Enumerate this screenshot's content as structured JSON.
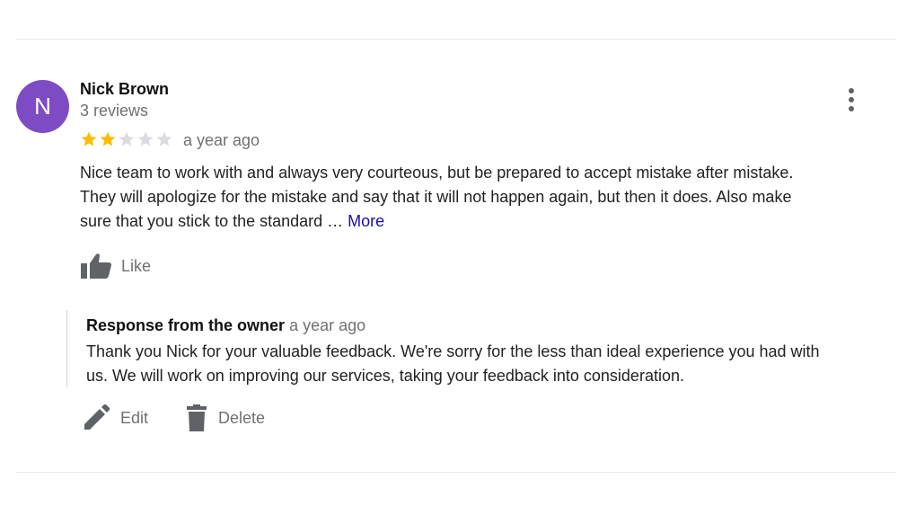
{
  "review": {
    "avatar_initial": "N",
    "avatar_color": "#7d4cc4",
    "author": "Nick Brown",
    "review_count": "3 reviews",
    "rating": 2,
    "max_rating": 5,
    "star_color_filled": "#fbbc04",
    "star_color_empty": "#dadce0",
    "time": "a year ago",
    "text_lines": [
      "Nice team to work with and always very courteous, but be prepared to accept mistake after mistake.",
      "They will apologize for the mistake and say that it will not happen again, but then it does.  Also make",
      "sure that you stick to the standard … "
    ],
    "more_label": "More",
    "like_label": "Like",
    "menu_icon": "more-vert-icon"
  },
  "owner_response": {
    "title": "Response from the owner",
    "time": "a year ago",
    "text_lines": [
      "Thank you Nick for your valuable feedback. We're sorry for the less than ideal experience you had with",
      "us. We will work on improving our services, taking your feedback into consideration."
    ]
  },
  "actions": {
    "edit_label": "Edit",
    "delete_label": "Delete",
    "edit_icon": "pencil-icon",
    "delete_icon": "trash-icon",
    "icon_color": "#5f6368"
  }
}
